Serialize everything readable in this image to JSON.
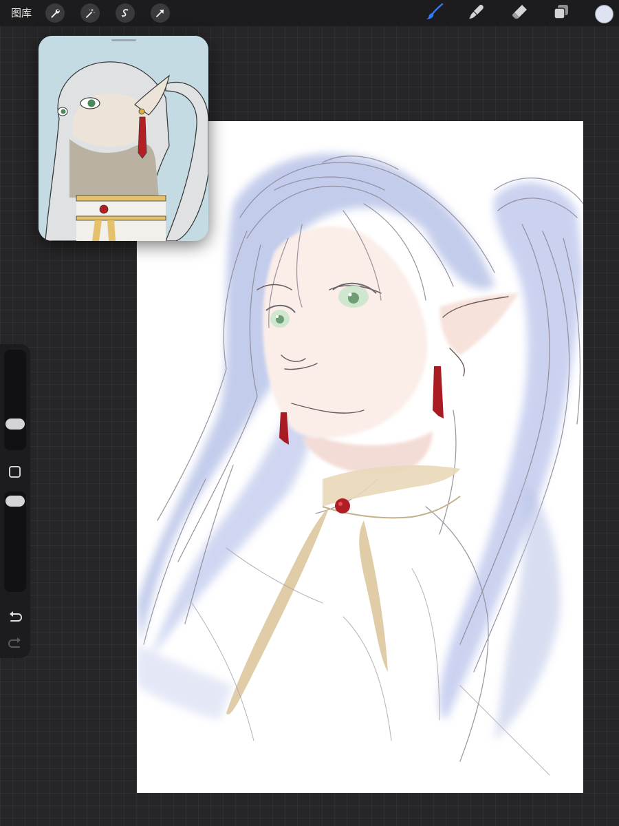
{
  "toolbar": {
    "gallery_label": "图库",
    "left_tools": [
      "wrench-icon",
      "magic-wand-icon",
      "selection-icon",
      "transform-arrow-icon"
    ],
    "right_tools": [
      "brush-icon",
      "smudge-icon",
      "eraser-icon",
      "layers-icon"
    ],
    "active_tool": "brush",
    "accent_color": "#2f7cf6",
    "current_color": "#dfe3f1"
  },
  "reference_window": {
    "background_color": "#c4dbe3"
  },
  "sidebar": {
    "brush_size": 0.2,
    "opacity": 1.0,
    "undo_icon": "undo-icon",
    "redo_icon": "redo-icon",
    "redo_enabled": false
  },
  "canvas": {
    "background_color": "#ffffff"
  }
}
